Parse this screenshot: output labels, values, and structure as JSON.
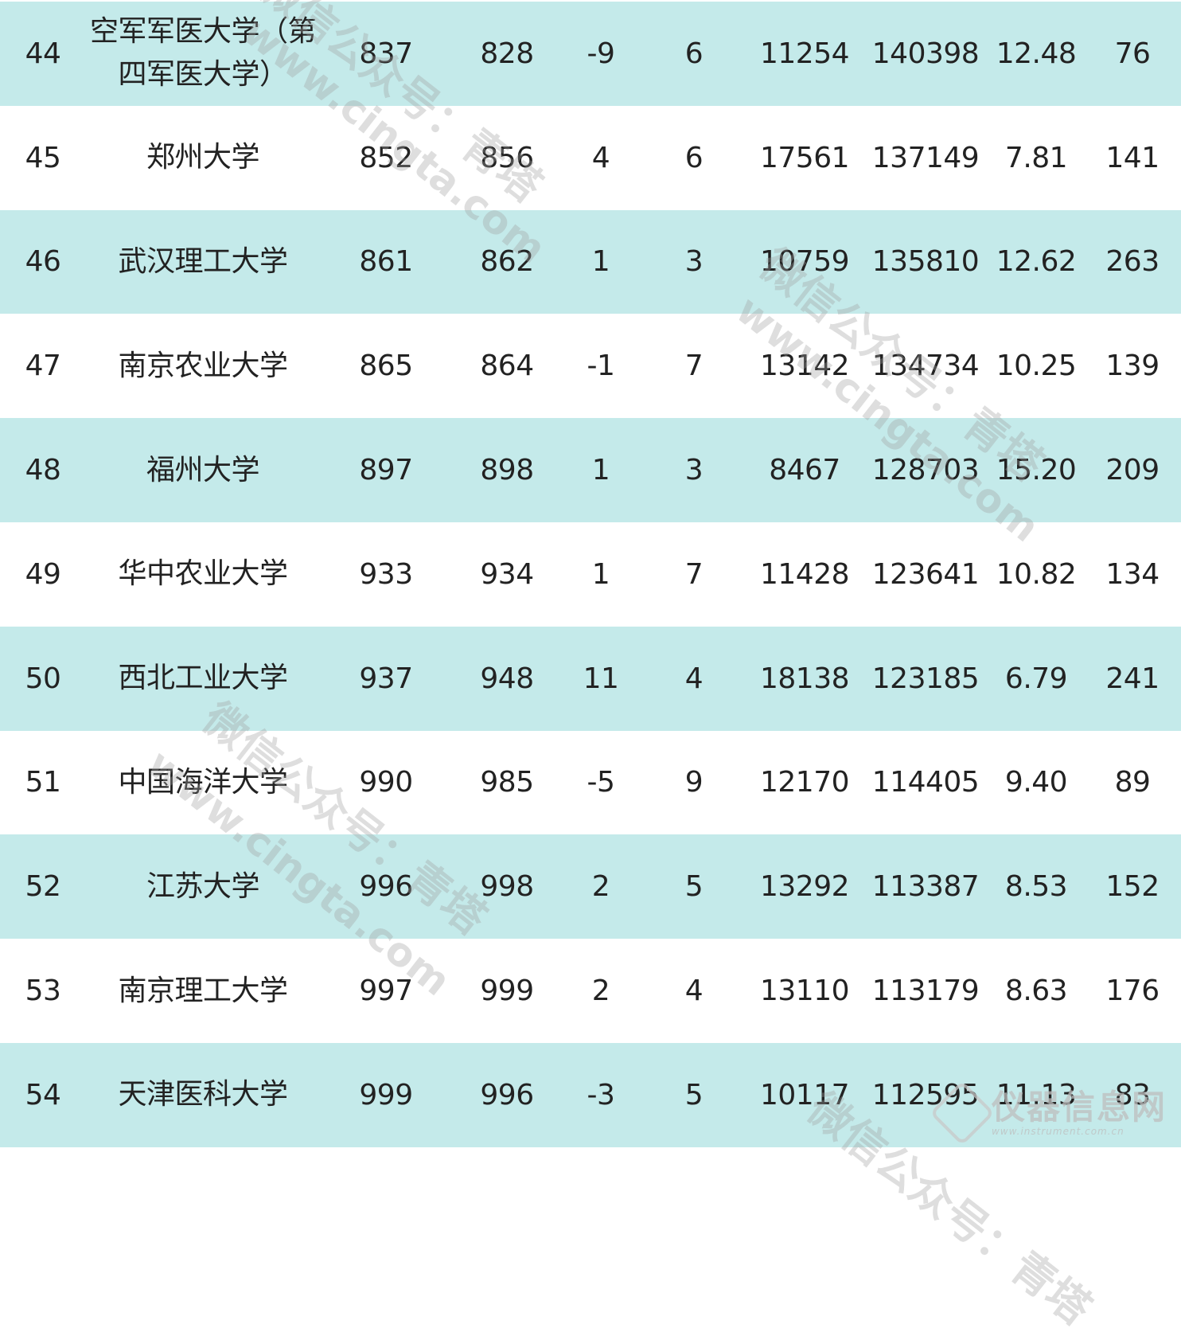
{
  "rows": [
    {
      "rank": "44",
      "name": "空军军医大学（第四军医大学）",
      "v1": "837",
      "v2": "828",
      "change": "-9",
      "n": "6",
      "a": "11254",
      "b": "140398",
      "ratio": "12.48",
      "last": "76"
    },
    {
      "rank": "45",
      "name": "郑州大学",
      "v1": "852",
      "v2": "856",
      "change": "4",
      "n": "6",
      "a": "17561",
      "b": "137149",
      "ratio": "7.81",
      "last": "141"
    },
    {
      "rank": "46",
      "name": "武汉理工大学",
      "v1": "861",
      "v2": "862",
      "change": "1",
      "n": "3",
      "a": "10759",
      "b": "135810",
      "ratio": "12.62",
      "last": "263"
    },
    {
      "rank": "47",
      "name": "南京农业大学",
      "v1": "865",
      "v2": "864",
      "change": "-1",
      "n": "7",
      "a": "13142",
      "b": "134734",
      "ratio": "10.25",
      "last": "139"
    },
    {
      "rank": "48",
      "name": "福州大学",
      "v1": "897",
      "v2": "898",
      "change": "1",
      "n": "3",
      "a": "8467",
      "b": "128703",
      "ratio": "15.20",
      "last": "209"
    },
    {
      "rank": "49",
      "name": "华中农业大学",
      "v1": "933",
      "v2": "934",
      "change": "1",
      "n": "7",
      "a": "11428",
      "b": "123641",
      "ratio": "10.82",
      "last": "134"
    },
    {
      "rank": "50",
      "name": "西北工业大学",
      "v1": "937",
      "v2": "948",
      "change": "11",
      "n": "4",
      "a": "18138",
      "b": "123185",
      "ratio": "6.79",
      "last": "241"
    },
    {
      "rank": "51",
      "name": "中国海洋大学",
      "v1": "990",
      "v2": "985",
      "change": "-5",
      "n": "9",
      "a": "12170",
      "b": "114405",
      "ratio": "9.40",
      "last": "89"
    },
    {
      "rank": "52",
      "name": "江苏大学",
      "v1": "996",
      "v2": "998",
      "change": "2",
      "n": "5",
      "a": "13292",
      "b": "113387",
      "ratio": "8.53",
      "last": "152"
    },
    {
      "rank": "53",
      "name": "南京理工大学",
      "v1": "997",
      "v2": "999",
      "change": "2",
      "n": "4",
      "a": "13110",
      "b": "113179",
      "ratio": "8.63",
      "last": "176"
    },
    {
      "rank": "54",
      "name": "天津医科大学",
      "v1": "999",
      "v2": "996",
      "change": "-3",
      "n": "5",
      "a": "10117",
      "b": "112595",
      "ratio": "11.13",
      "last": "83"
    }
  ],
  "watermark": {
    "text": "微信公众号：青塔",
    "url": "www.cingta.com"
  },
  "logo": {
    "name": "仪器信息网",
    "url": "www.instrument.com.cn"
  },
  "colors": {
    "band": "#c4eaea",
    "text": "#222222"
  }
}
